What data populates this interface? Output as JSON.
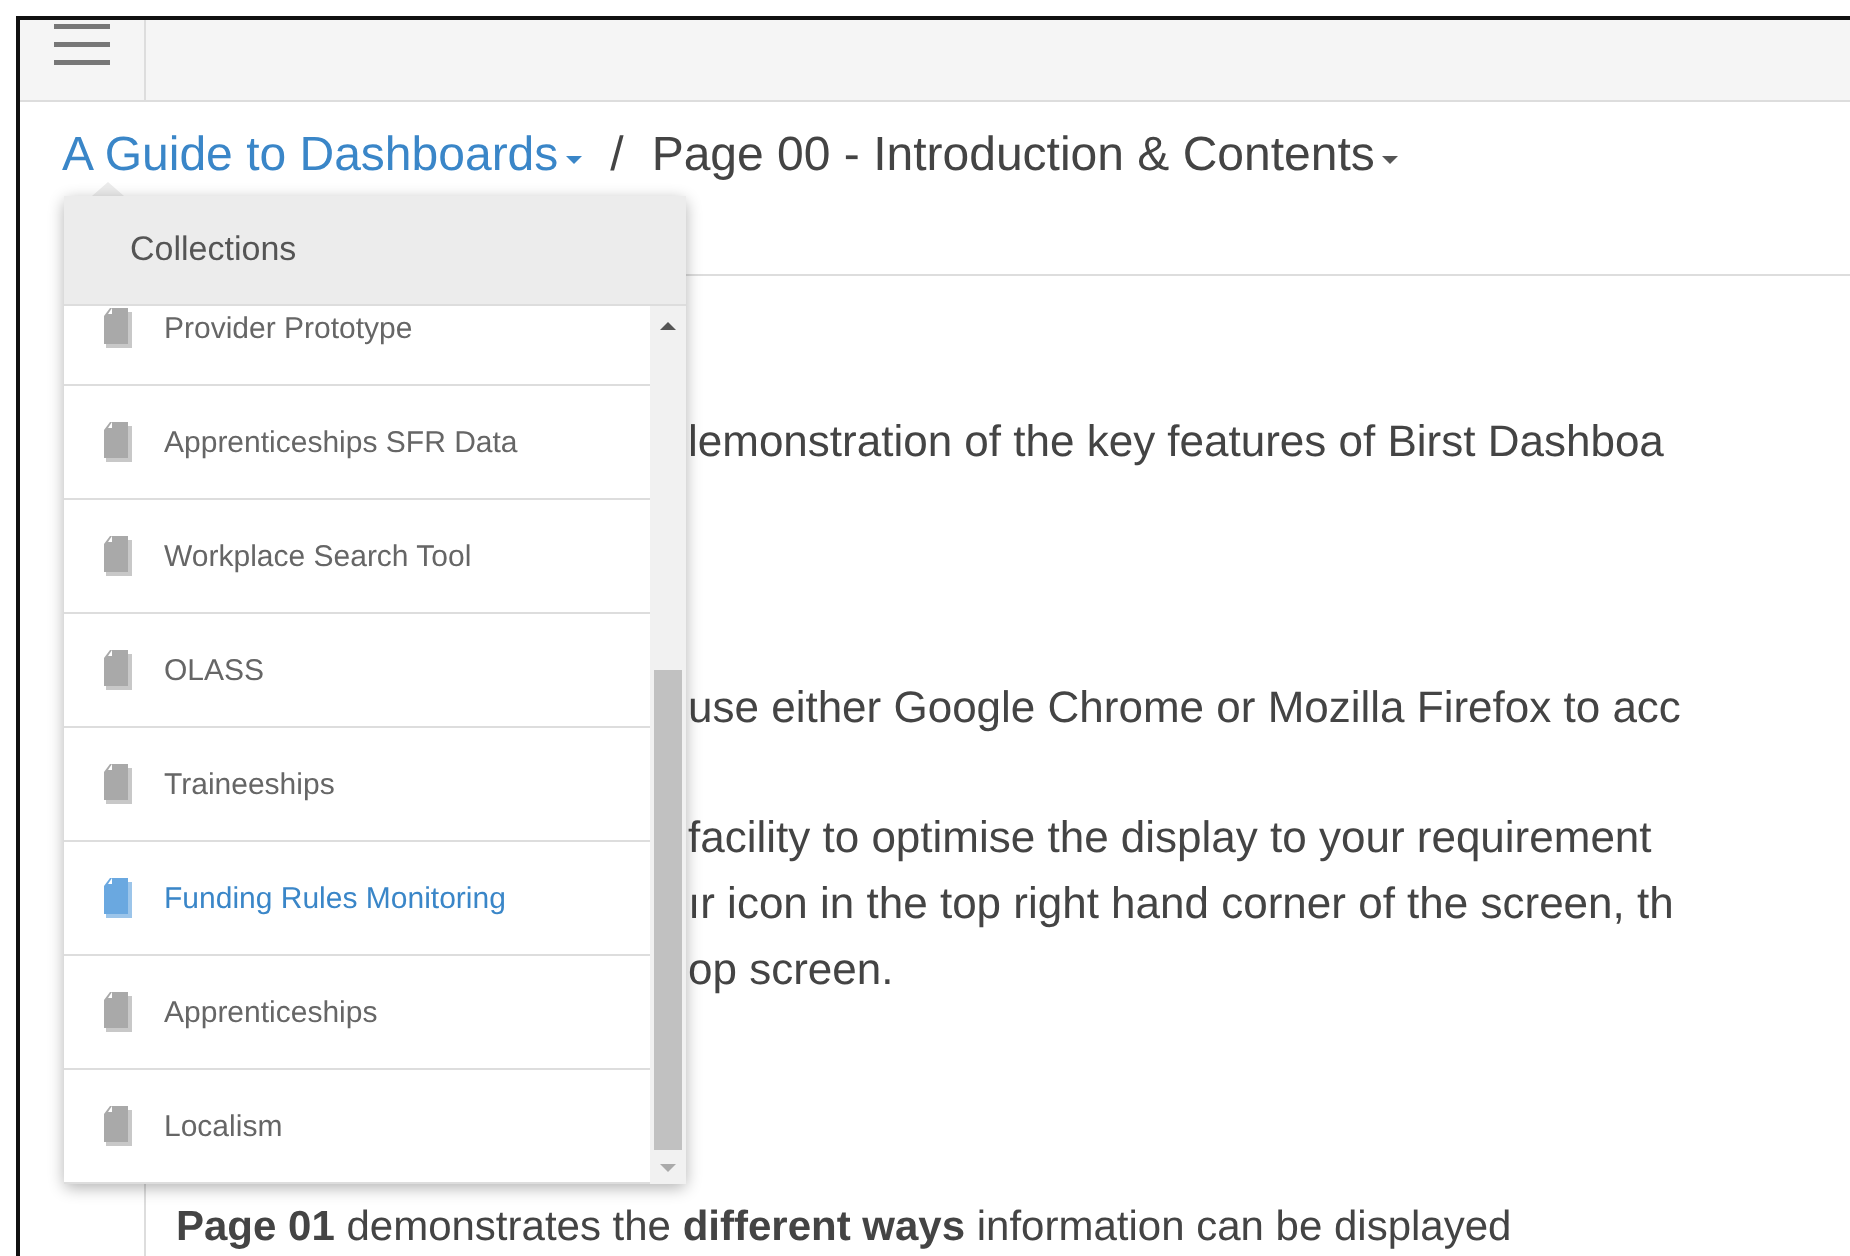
{
  "breadcrumb": {
    "collection": "A Guide to Dashboards",
    "separator": "/",
    "page": "Page 00 - Introduction & Contents"
  },
  "dropdown": {
    "header": "Collections",
    "items": [
      {
        "label": "Provider Prototype",
        "selected": false
      },
      {
        "label": "Apprenticeships SFR Data",
        "selected": false
      },
      {
        "label": "Workplace Search Tool",
        "selected": false
      },
      {
        "label": "OLASS",
        "selected": false
      },
      {
        "label": "Traineeships",
        "selected": false
      },
      {
        "label": "Funding Rules Monitoring",
        "selected": true
      },
      {
        "label": "Apprenticeships",
        "selected": false
      },
      {
        "label": "Localism",
        "selected": false
      }
    ]
  },
  "content": {
    "paragraphs": [
      {
        "lines": [
          "lemonstration of the key features of Birst Dashboa"
        ]
      },
      {
        "lines": [
          "use either Google Chrome or Mozilla Firefox to acc"
        ]
      },
      {
        "lines": [
          "facility to optimise the display to your requirement",
          "ır icon in the top right hand corner of the screen, th",
          "op screen."
        ]
      }
    ],
    "footer_line": "**Page 01** demonstrates the **different ways** information can be displayed"
  }
}
